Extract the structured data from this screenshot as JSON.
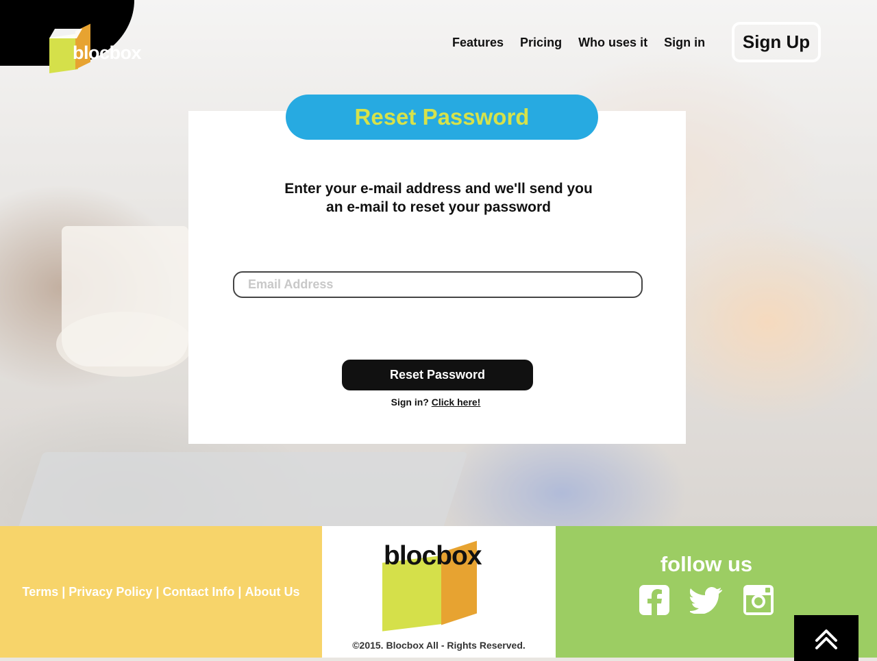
{
  "header": {
    "logo_text": "blocbox",
    "nav": [
      "Features",
      "Pricing",
      "Who uses it",
      "Sign in"
    ],
    "signup_label": "Sign Up"
  },
  "card": {
    "title": "Reset Password",
    "instructions_line1": "Enter your e-mail address and we'll send you",
    "instructions_line2": "an e-mail to reset your password",
    "email_placeholder": "Email Address",
    "submit_label": "Reset Password",
    "signin_prompt": "Sign in?",
    "signin_link": "Click here!"
  },
  "footer": {
    "links": [
      "Terms",
      "Privacy Policy",
      "Contact Info",
      "About Us"
    ],
    "separator": "|",
    "logo_text": "blocbox",
    "copyright": "©2015. Blocbox All - Rights Reserved.",
    "follow_label": "follow us",
    "social_icons": [
      "facebook-icon",
      "twitter-icon",
      "instagram-icon"
    ]
  },
  "colors": {
    "brand_blue": "#27aae1",
    "brand_lime": "#d6e24b",
    "footer_yellow": "#f7d46a",
    "footer_green": "#9ccd63",
    "brand_orange": "#e7a331"
  },
  "icons": {
    "back_to_top": "double-chevron-up-icon"
  }
}
